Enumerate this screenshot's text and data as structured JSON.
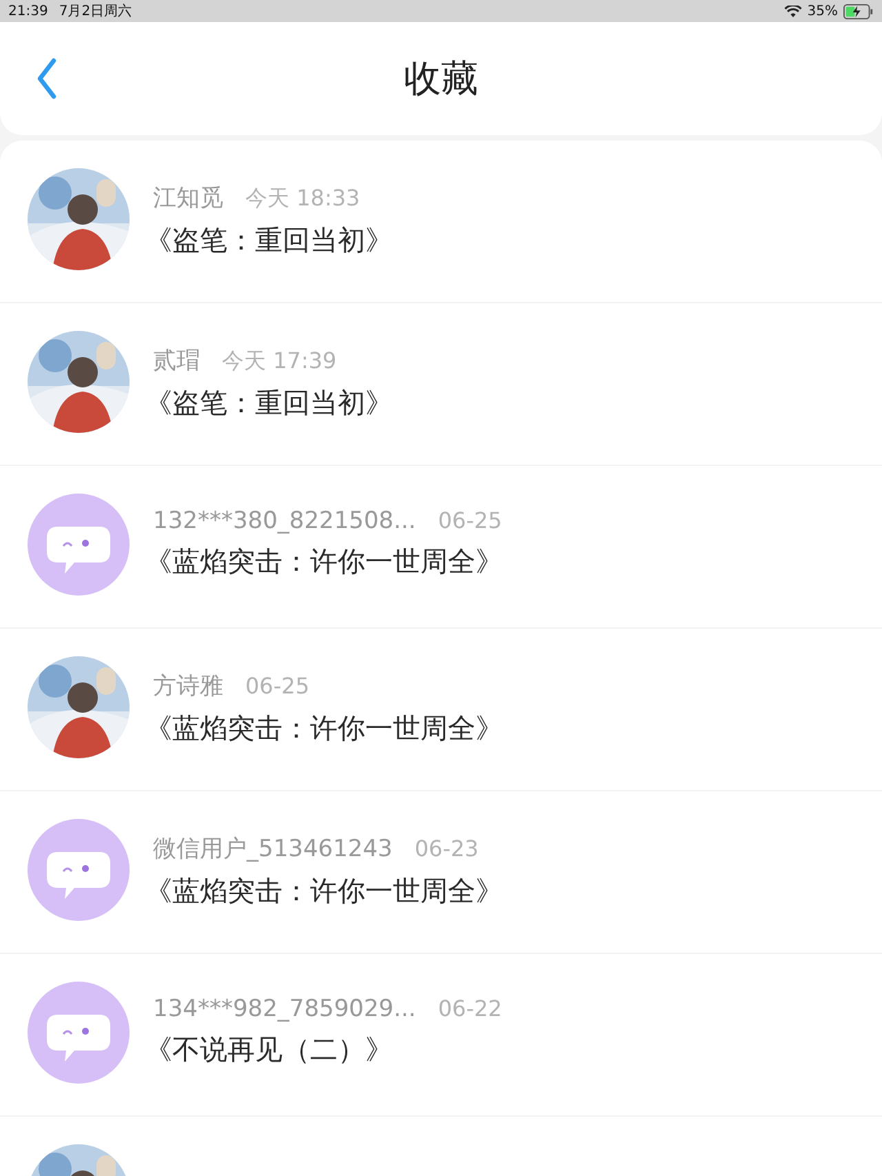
{
  "status_bar": {
    "time": "21:39",
    "date": "7月2日周六",
    "battery": "35%"
  },
  "header": {
    "title": "收藏"
  },
  "items": [
    {
      "kind": "picture",
      "name": "江知觅",
      "time": "今天 18:33",
      "title": "《盗笔：重回当初》"
    },
    {
      "kind": "picture",
      "name": "贰瑁",
      "time": "今天 17:39",
      "title": "《盗笔：重回当初》"
    },
    {
      "kind": "default",
      "name": "132***380_8221508...",
      "time": "06-25",
      "title": "《蓝焰突击：许你一世周全》"
    },
    {
      "kind": "picture",
      "name": "方诗雅",
      "time": "06-25",
      "title": "《蓝焰突击：许你一世周全》"
    },
    {
      "kind": "default",
      "name": "微信用户_513461243",
      "time": "06-23",
      "title": "《蓝焰突击：许你一世周全》"
    },
    {
      "kind": "default",
      "name": "134***982_7859029...",
      "time": "06-22",
      "title": "《不说再见（二）》"
    },
    {
      "kind": "picture"
    }
  ]
}
